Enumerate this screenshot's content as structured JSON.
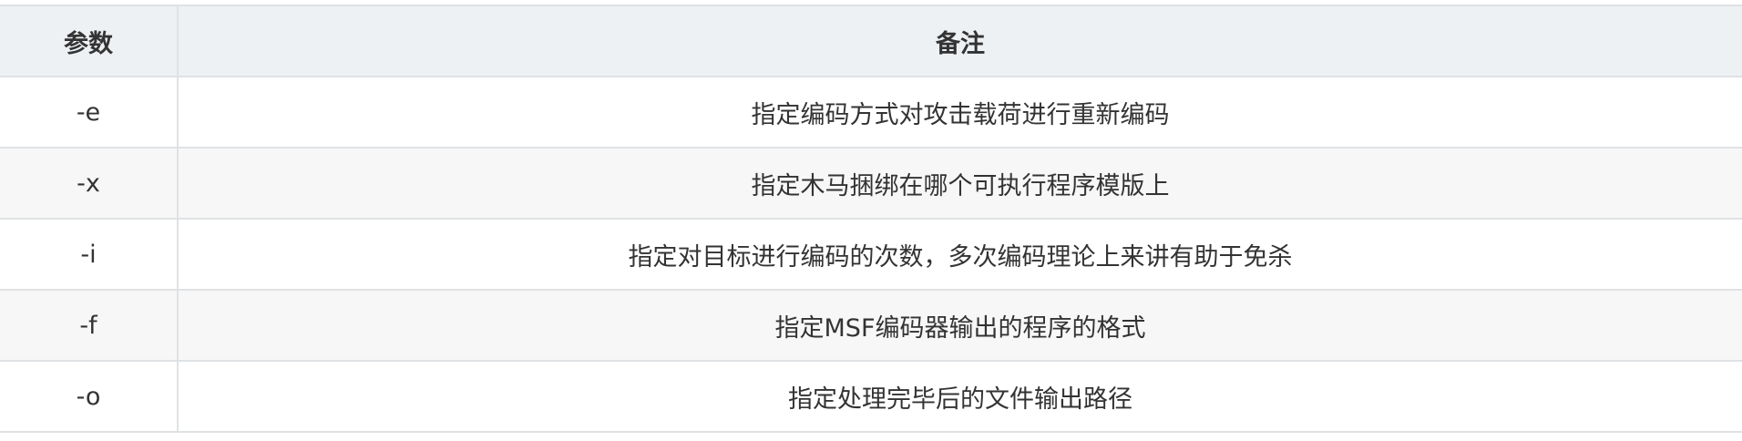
{
  "table": {
    "headers": [
      "参数",
      "备注"
    ],
    "rows": [
      {
        "param": "-e",
        "note": "指定编码方式对攻击载荷进行重新编码"
      },
      {
        "param": "-x",
        "note": "指定木马捆绑在哪个可执行程序模版上"
      },
      {
        "param": "-i",
        "note": "指定对目标进行编码的次数，多次编码理论上来讲有助于免杀"
      },
      {
        "param": "-f",
        "note": "指定MSF编码器输出的程序的格式"
      },
      {
        "param": "-o",
        "note": "指定处理完毕后的文件输出路径"
      }
    ]
  },
  "colors": {
    "header_bg": "#eef1f4",
    "stripe_bg": "#f7f7f7",
    "border": "#dfe2e5",
    "text": "#333333"
  }
}
